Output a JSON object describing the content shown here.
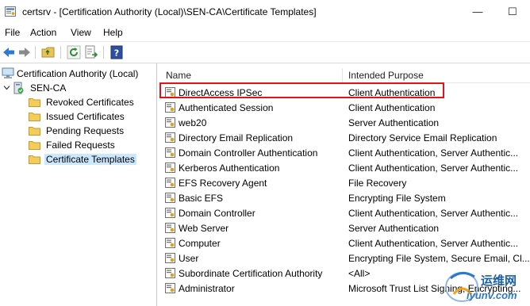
{
  "window": {
    "title": "certsrv - [Certification Authority (Local)\\SEN-CA\\Certificate Templates]",
    "minimize_glyph": "—",
    "maximize_glyph": "☐"
  },
  "menu": [
    "File",
    "Action",
    "View",
    "Help"
  ],
  "toolbar": {
    "icons": [
      "back-arrow-icon",
      "forward-arrow-icon",
      "up-folder-icon",
      "refresh-icon",
      "export-list-icon",
      "help-icon"
    ]
  },
  "tree": {
    "root": "Certification Authority (Local)",
    "ca": "SEN-CA",
    "children": [
      "Revoked Certificates",
      "Issued Certificates",
      "Pending Requests",
      "Failed Requests",
      "Certificate Templates"
    ],
    "selected": "Certificate Templates"
  },
  "list": {
    "columns": [
      "Name",
      "Intended Purpose"
    ],
    "rows": [
      {
        "name": "DirectAccess IPSec",
        "purpose": "Client Authentication"
      },
      {
        "name": "Authenticated Session",
        "purpose": "Client Authentication"
      },
      {
        "name": "web20",
        "purpose": "Server Authentication"
      },
      {
        "name": "Directory Email Replication",
        "purpose": "Directory Service Email Replication"
      },
      {
        "name": "Domain Controller Authentication",
        "purpose": "Client Authentication, Server Authentic..."
      },
      {
        "name": "Kerberos Authentication",
        "purpose": "Client Authentication, Server Authentic..."
      },
      {
        "name": "EFS Recovery Agent",
        "purpose": "File Recovery"
      },
      {
        "name": "Basic EFS",
        "purpose": "Encrypting File System"
      },
      {
        "name": "Domain Controller",
        "purpose": "Client Authentication, Server Authentic..."
      },
      {
        "name": "Web Server",
        "purpose": "Server Authentication"
      },
      {
        "name": "Computer",
        "purpose": "Client Authentication, Server Authentic..."
      },
      {
        "name": "User",
        "purpose": "Encrypting File System, Secure Email, Cl..."
      },
      {
        "name": "Subordinate Certification Authority",
        "purpose": "<All>"
      },
      {
        "name": "Administrator",
        "purpose": "Microsoft Trust List Signing, Encrypting..."
      }
    ]
  },
  "watermark": {
    "text": "运维网",
    "url": "iyunv.com"
  },
  "colors": {
    "highlight": "#e0121b",
    "selection": "#cce8ff"
  }
}
